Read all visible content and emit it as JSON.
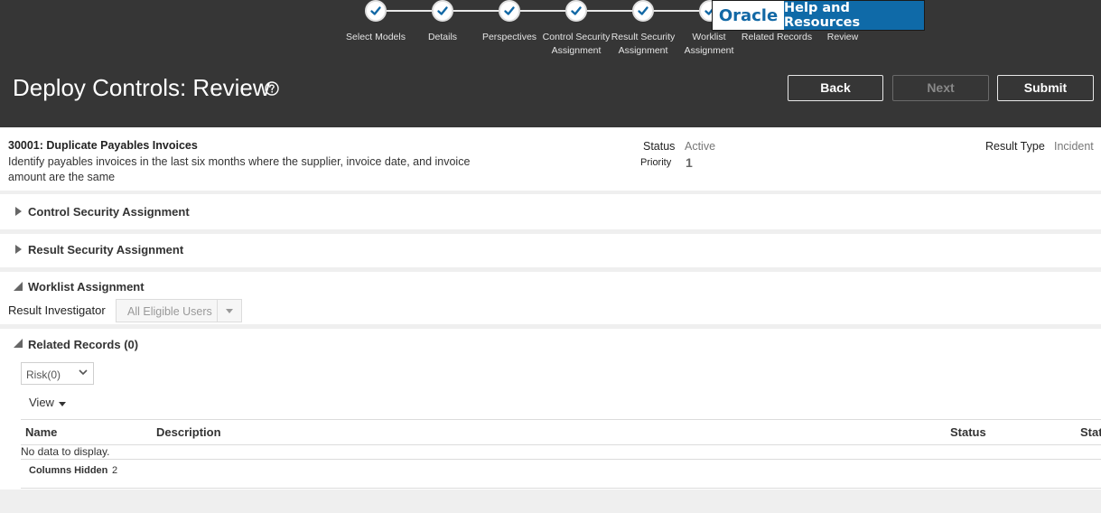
{
  "train": {
    "steps": [
      {
        "label": "Select Models",
        "done": true
      },
      {
        "label": "Details",
        "done": true
      },
      {
        "label": "Perspectives",
        "done": true
      },
      {
        "label": "Control Security Assignment",
        "done": true
      },
      {
        "label": "Result Security Assignment",
        "done": true
      },
      {
        "label": "Worklist Assignment",
        "done": true
      },
      {
        "label": "Related Records",
        "done": false
      },
      {
        "label": "Review",
        "done": false
      }
    ]
  },
  "banner": {
    "brand": "Oracle",
    "text": "Help and Resources"
  },
  "header": {
    "title": "Deploy Controls: Review",
    "back_label": "Back",
    "next_label": "Next",
    "submit_label": "Submit"
  },
  "control": {
    "title": "30001: Duplicate Payables Invoices",
    "description": "Identify payables invoices in the last six months where the supplier, invoice date, and invoice amount are the same",
    "status_label": "Status",
    "status_value": "Active",
    "priority_label": "Priority",
    "priority_value": "1",
    "result_type_label": "Result Type",
    "result_type_value": "Incident"
  },
  "sections": {
    "control_security": "Control Security Assignment",
    "result_security": "Result Security Assignment",
    "worklist": "Worklist Assignment",
    "related_records": "Related Records (0)"
  },
  "worklist": {
    "investigator_label": "Result Investigator",
    "investigator_value": "All Eligible Users"
  },
  "related": {
    "filter_value": "Risk(0)",
    "view_label": "View",
    "columns": [
      "Name",
      "Description",
      "Status",
      "Stat"
    ],
    "empty_text": "No data to display.",
    "columns_hidden_label": "Columns Hidden",
    "columns_hidden_count": "2"
  },
  "colors": {
    "header_bg": "#363636",
    "banner_blue": "#0f6aa8",
    "check_blue": "#1268a5"
  }
}
